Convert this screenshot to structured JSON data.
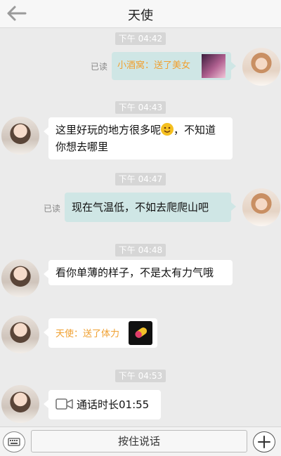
{
  "header": {
    "title": "天使"
  },
  "messages": {
    "m1": {
      "time": "下午 04:42",
      "read": "已读",
      "gift": "小酒窝：送了美女"
    },
    "m2": {
      "time": "下午 04:43",
      "text": "这里好玩的地方很多呢",
      "text_after": "，不知道你想去哪里"
    },
    "m3": {
      "time": "下午 04:47",
      "read": "已读",
      "text": "现在气温低，不如去爬爬山吧"
    },
    "m4": {
      "time": "下午 04:48",
      "text": "看你单薄的样子，不是太有力气哦"
    },
    "m5": {
      "gift": "天使：送了体力"
    },
    "m6": {
      "time": "下午 04:53",
      "text": "通话时长01:55"
    }
  },
  "bottom": {
    "hold_to_talk": "按住说话"
  },
  "colors": {
    "bg": "#ebebeb",
    "my_bubble": "#cfe6e5",
    "gift_text": "#f0a030"
  }
}
